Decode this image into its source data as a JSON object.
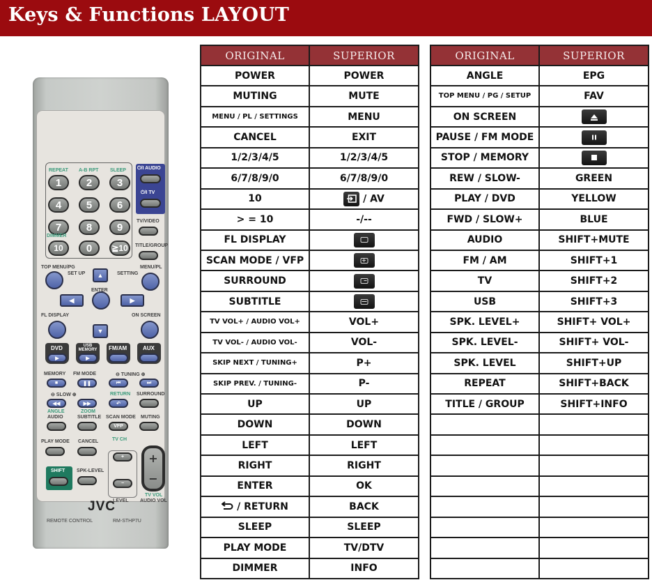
{
  "header": {
    "title": "Keys & Functions LAYOUT"
  },
  "colors": {
    "banner": "#9b0b0f",
    "table_header": "#943236"
  },
  "remote": {
    "brand": "JVC",
    "model": "RM-STHP7U",
    "remote_control_label": "REMOTE CONTROL",
    "labels": {
      "repeat": "REPEAT",
      "ab_rpt": "A-B RPT",
      "sleep": "SLEEP",
      "audio_power": "⏻/I AUDIO",
      "tv_power": "⏻/I TV",
      "tv_video": "TV/VIDEO",
      "dimmer": "DIMMER",
      "title_group": "TITLE/GROUP",
      "top_menu": "TOP MENU/PG",
      "set_up": "SET UP",
      "setting": "SETTING",
      "menu_pl": "MENU/PL",
      "enter": "ENTER",
      "fl_display": "FL DISPLAY",
      "on_screen": "ON SCREEN",
      "dvd": "DVD",
      "usb_memory": "USB MEMORY",
      "fm_am": "FM/AM",
      "aux": "AUX",
      "memory": "MEMORY",
      "fm_mode": "FM MODE",
      "tuning": "⊖ TUNING ⊕",
      "slow": "⊖ SLOW ⊕",
      "return": "RETURN",
      "surround": "SURROUND",
      "angle": "ANGLE",
      "zoom": "ZOOM",
      "audio": "AUDIO",
      "subtitle": "SUBTITLE",
      "scan_mode": "SCAN MODE",
      "vfp": "VFP",
      "muting": "MUTING",
      "play_mode": "PLAY MODE",
      "cancel": "CANCEL",
      "tv_ch": "TV CH",
      "shift": "SHIFT",
      "spk_level": "SPK-LEVEL",
      "level": "LEVEL",
      "tv_vol": "TV VOL",
      "audio_vol": "AUDIO VOL"
    },
    "number_keys": [
      "1",
      "2",
      "3",
      "4",
      "5",
      "6",
      "7",
      "8",
      "9",
      "10",
      "0",
      "≧10"
    ]
  },
  "tables": {
    "headers": {
      "original": "ORIGINAL",
      "superior": "SUPERIOR"
    },
    "left": [
      {
        "original": "POWER",
        "superior": "POWER"
      },
      {
        "original": "MUTING",
        "superior": "MUTE"
      },
      {
        "original": "MENU / PL / SETTINGS",
        "superior": "MENU"
      },
      {
        "original": "CANCEL",
        "superior": "EXIT"
      },
      {
        "original": "1/2/3/4/5",
        "superior": "1/2/3/4/5"
      },
      {
        "original": "6/7/8/9/0",
        "superior": "6/7/8/9/0"
      },
      {
        "original": "10",
        "superior": "/ AV",
        "superior_icon": "input-source-icon"
      },
      {
        "original": "> = 10",
        "superior": "-/--"
      },
      {
        "original": "FL DISPLAY",
        "superior": "",
        "superior_icon": "screen-rect-icon"
      },
      {
        "original": "SCAN MODE / VFP",
        "superior": "",
        "superior_icon": "zoom-plus-icon"
      },
      {
        "original": "SURROUND",
        "superior": "",
        "superior_icon": "subtitle-box-icon"
      },
      {
        "original": "SUBTITLE",
        "superior": "",
        "superior_icon": "teletext-icon"
      },
      {
        "original": "TV VOL+ / AUDIO VOL+",
        "superior": "VOL+"
      },
      {
        "original": "TV VOL- / AUDIO VOL-",
        "superior": "VOL-"
      },
      {
        "original": "SKIP NEXT / TUNING+",
        "superior": "P+"
      },
      {
        "original": "SKIP PREV. / TUNING-",
        "superior": "P-"
      },
      {
        "original": "UP",
        "superior": "UP"
      },
      {
        "original": "DOWN",
        "superior": "DOWN"
      },
      {
        "original": "LEFT",
        "superior": "LEFT"
      },
      {
        "original": "RIGHT",
        "superior": "RIGHT"
      },
      {
        "original": "ENTER",
        "superior": "OK"
      },
      {
        "original": "/ RETURN",
        "original_icon": "return-arrow-icon",
        "superior": "BACK"
      },
      {
        "original": "SLEEP",
        "superior": "SLEEP"
      },
      {
        "original": "PLAY MODE",
        "superior": "TV/DTV"
      },
      {
        "original": "DIMMER",
        "superior": "INFO"
      }
    ],
    "right": [
      {
        "original": "ANGLE",
        "superior": "EPG"
      },
      {
        "original": "TOP MENU / PG / SETUP",
        "superior": "FAV"
      },
      {
        "original": "ON SCREEN",
        "superior": "",
        "superior_icon": "eject-icon"
      },
      {
        "original": "PAUSE / FM MODE",
        "superior": "",
        "superior_icon": "pause-icon"
      },
      {
        "original": "STOP / MEMORY",
        "superior": "",
        "superior_icon": "stop-icon"
      },
      {
        "original": "REW / SLOW-",
        "superior": "GREEN"
      },
      {
        "original": "PLAY / DVD",
        "superior": "YELLOW"
      },
      {
        "original": "FWD / SLOW+",
        "superior": "BLUE"
      },
      {
        "original": "AUDIO",
        "superior": "SHIFT+MUTE"
      },
      {
        "original": "FM / AM",
        "superior": "SHIFT+1"
      },
      {
        "original": "TV",
        "superior": "SHIFT+2"
      },
      {
        "original": "USB",
        "superior": "SHIFT+3"
      },
      {
        "original": "SPK. LEVEL+",
        "superior": "SHIFT+ VOL+"
      },
      {
        "original": "SPK. LEVEL-",
        "superior": "SHIFT+ VOL-"
      },
      {
        "original": "SPK. LEVEL",
        "superior": "SHIFT+UP"
      },
      {
        "original": "REPEAT",
        "superior": "SHIFT+BACK"
      },
      {
        "original": "TITLE / GROUP",
        "superior": "SHIFT+INFO"
      },
      {
        "original": "",
        "superior": ""
      },
      {
        "original": "",
        "superior": ""
      },
      {
        "original": "",
        "superior": ""
      },
      {
        "original": "",
        "superior": ""
      },
      {
        "original": "",
        "superior": ""
      },
      {
        "original": "",
        "superior": ""
      },
      {
        "original": "",
        "superior": ""
      },
      {
        "original": "",
        "superior": ""
      }
    ]
  }
}
